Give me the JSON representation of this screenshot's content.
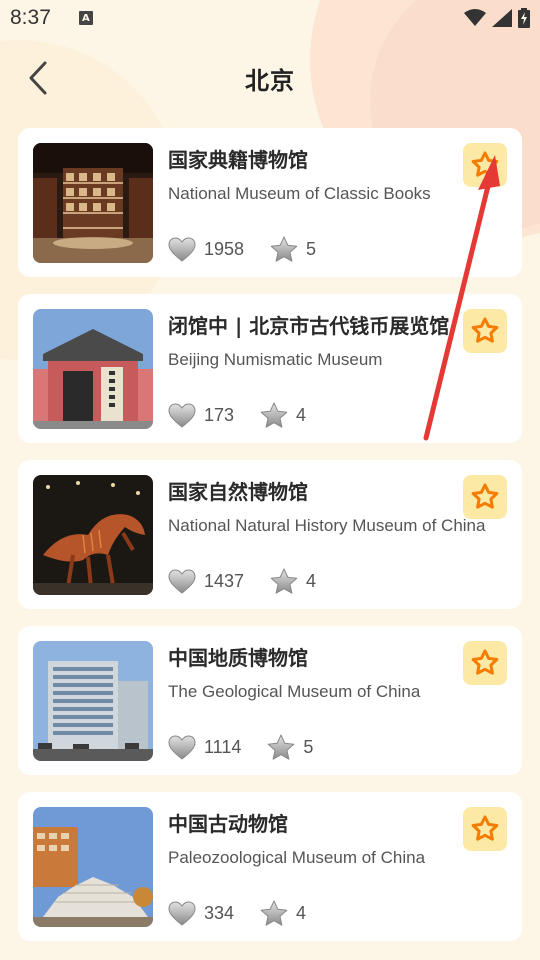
{
  "status_bar": {
    "time": "8:37",
    "indicator_letter": "A",
    "icons": [
      "wifi-icon",
      "signal-icon",
      "battery-charging-icon"
    ]
  },
  "header": {
    "title": "北京",
    "back_icon": "chevron-left-icon"
  },
  "colors": {
    "background": "#fdf6e6",
    "card": "#ffffff",
    "fav_bg": "#fde9a6",
    "fav_star": "#f57c00",
    "annotation_arrow": "#e53935"
  },
  "museums": [
    {
      "title": "国家典籍博物馆",
      "subtitle": "National Museum of Classic Books",
      "likes": "1958",
      "rating": "5"
    },
    {
      "title": "闭馆中 | 北京市古代钱币展览馆",
      "subtitle": "Beijing Numismatic Museum",
      "likes": "173",
      "rating": "4"
    },
    {
      "title": "国家自然博物馆",
      "subtitle": "National Natural History Museum of China",
      "likes": "1437",
      "rating": "4"
    },
    {
      "title": "中国地质博物馆",
      "subtitle": "The Geological Museum of China",
      "likes": "1114",
      "rating": "5"
    },
    {
      "title": "中国古动物馆",
      "subtitle": "Paleozoological Museum of China",
      "likes": "334",
      "rating": "4"
    }
  ]
}
